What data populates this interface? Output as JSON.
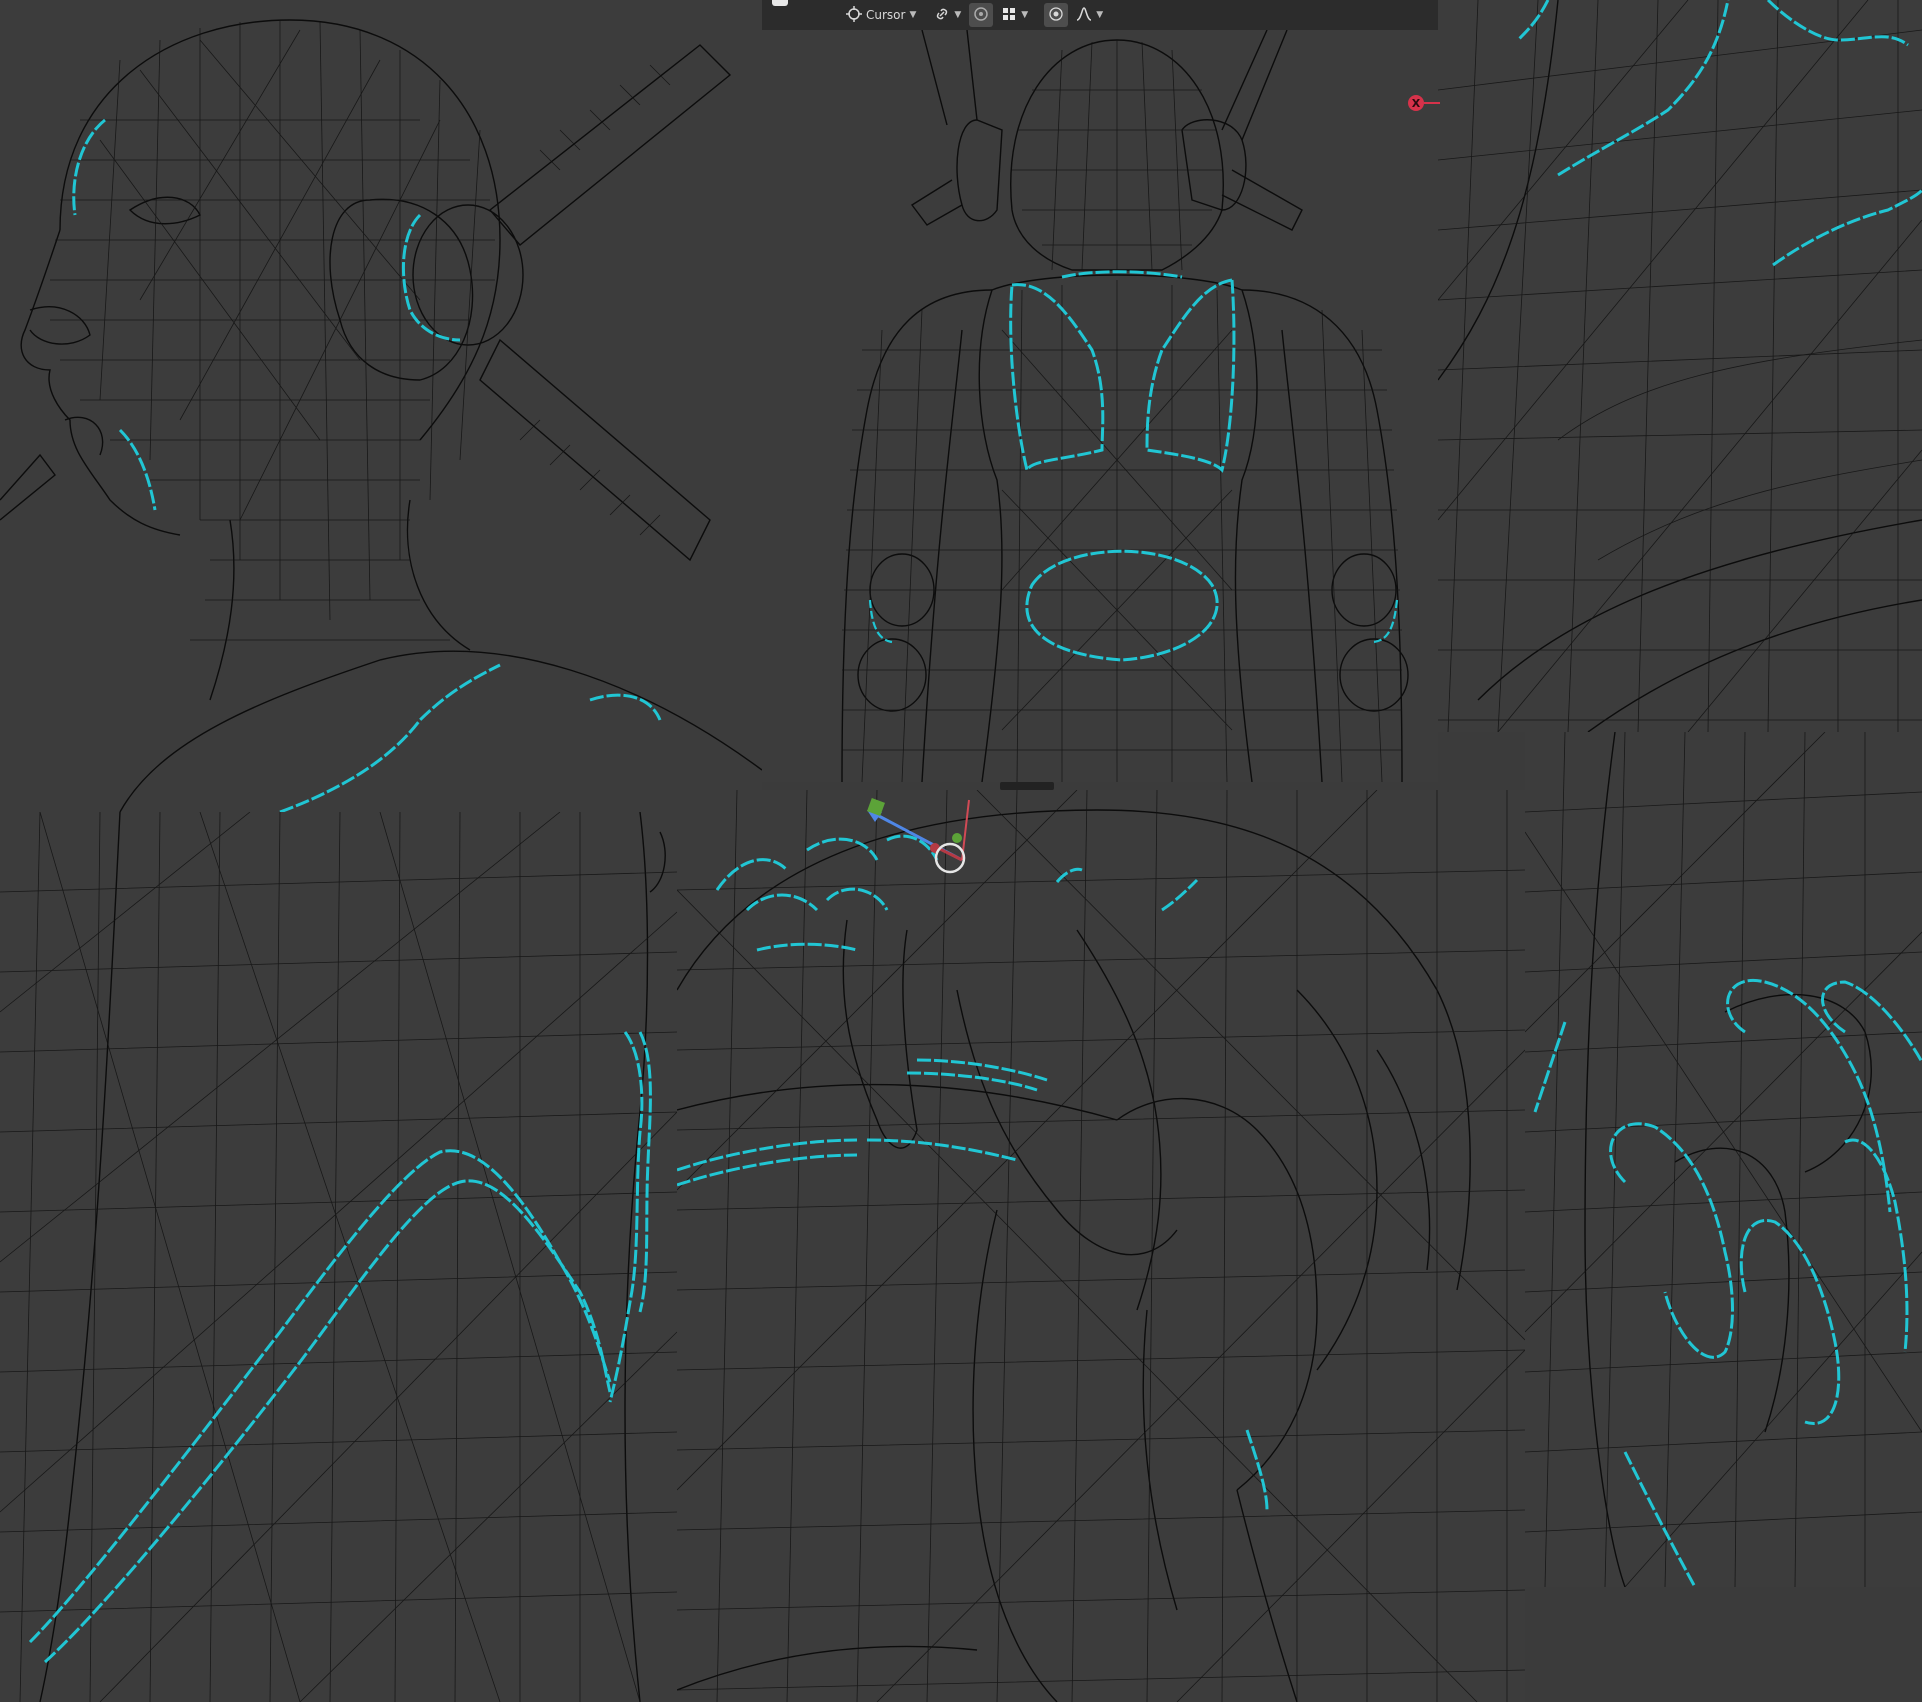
{
  "header": {
    "pivot_label": "Cursor",
    "pivot_icon": "pivot-cursor-icon",
    "snap_icon": "link-icon",
    "snap_grid_icon": "snap-grid-icon",
    "proportional_icon": "proportional-edit-icon",
    "falloff_icon": "falloff-curve-icon"
  },
  "gizmo": {
    "x_axis_label": "X",
    "x_axis_color": "#d6324a"
  },
  "colors": {
    "background": "#3c3c3c",
    "seam": "#21c6d4",
    "wireframe": "#121212",
    "toolbar": "#2c2c2c"
  },
  "panels": [
    {
      "id": "head-side",
      "description_name": "head-side-viewport"
    },
    {
      "id": "back-view",
      "description_name": "back-view-viewport"
    },
    {
      "id": "shoulder-closeup",
      "description_name": "shoulder-closeup-viewport"
    },
    {
      "id": "arm-closeup",
      "description_name": "arm-closeup-viewport"
    },
    {
      "id": "hand-closeup",
      "description_name": "hand-closeup-viewport"
    },
    {
      "id": "fingers-closeup",
      "description_name": "fingers-closeup-viewport"
    }
  ]
}
